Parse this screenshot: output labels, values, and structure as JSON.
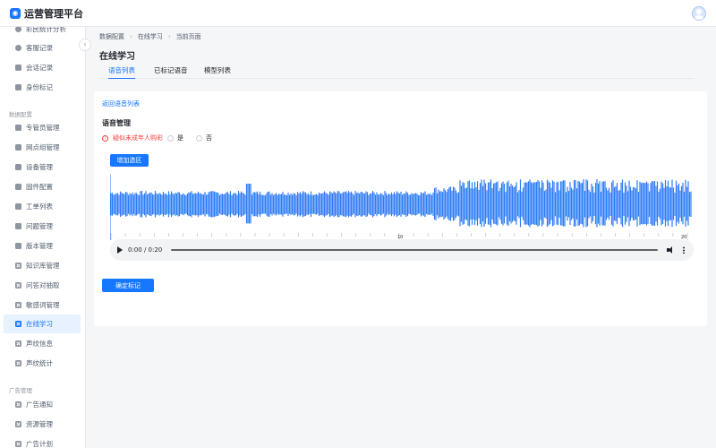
{
  "app": {
    "title": "运营管理平台",
    "logo_icon": "chat-bubble-icon",
    "brand_color": "#1677ff"
  },
  "sidebar": {
    "top_items": [
      {
        "label": "彩民统计分析",
        "icon": "dot-icon"
      },
      {
        "label": "客服记录",
        "icon": "dot-icon"
      },
      {
        "label": "会话记录",
        "icon": "doc-icon"
      },
      {
        "label": "身份标记",
        "icon": "doc-icon"
      }
    ],
    "group_data": "数据配置",
    "data_items": [
      {
        "label": "专管员管理",
        "icon": "folder-icon"
      },
      {
        "label": "网点组管理",
        "icon": "grid-icon"
      },
      {
        "label": "设备管理",
        "icon": "doc-icon"
      },
      {
        "label": "固件配置",
        "icon": "doc-icon"
      },
      {
        "label": "工单列表",
        "icon": "doc-icon"
      },
      {
        "label": "问题管理",
        "icon": "doc-icon"
      },
      {
        "label": "版本管理",
        "icon": "doc-icon"
      },
      {
        "label": "知识库管理",
        "icon": "x-box-icon"
      },
      {
        "label": "问答对抽取",
        "icon": "x-box-icon"
      },
      {
        "label": "敏感词管理",
        "icon": "x-box-icon"
      },
      {
        "label": "在线学习",
        "icon": "x-box-icon",
        "active": true
      },
      {
        "label": "声纹信息",
        "icon": "x-box-icon"
      },
      {
        "label": "声纹统计",
        "icon": "x-box-icon"
      }
    ],
    "group_ads": "广告管理",
    "ads_items": [
      {
        "label": "广告通知",
        "icon": "x-box-icon"
      },
      {
        "label": "资源管理",
        "icon": "x-box-icon"
      },
      {
        "label": "广告计划",
        "icon": "x-box-icon"
      }
    ]
  },
  "breadcrumb": [
    "数据配置",
    "在线学习",
    "当前页面"
  ],
  "page_title": "在线学习",
  "tabs": [
    {
      "label": "语音列表",
      "active": true
    },
    {
      "label": "已标记语音",
      "active": false
    },
    {
      "label": "模型列表",
      "active": false
    }
  ],
  "content": {
    "back_link": "返回语音列表",
    "section_title": "语音管理",
    "question": "疑似未成年人购彩",
    "options": [
      "是",
      "否"
    ],
    "add_region_button": "增加选区",
    "waveform": {
      "color": "#2f7cf6",
      "duration_seconds": 20,
      "tick_labels": [
        "10",
        "20"
      ]
    },
    "player": {
      "time": "0:00 / 0:20"
    },
    "confirm_button": "确定标记"
  }
}
